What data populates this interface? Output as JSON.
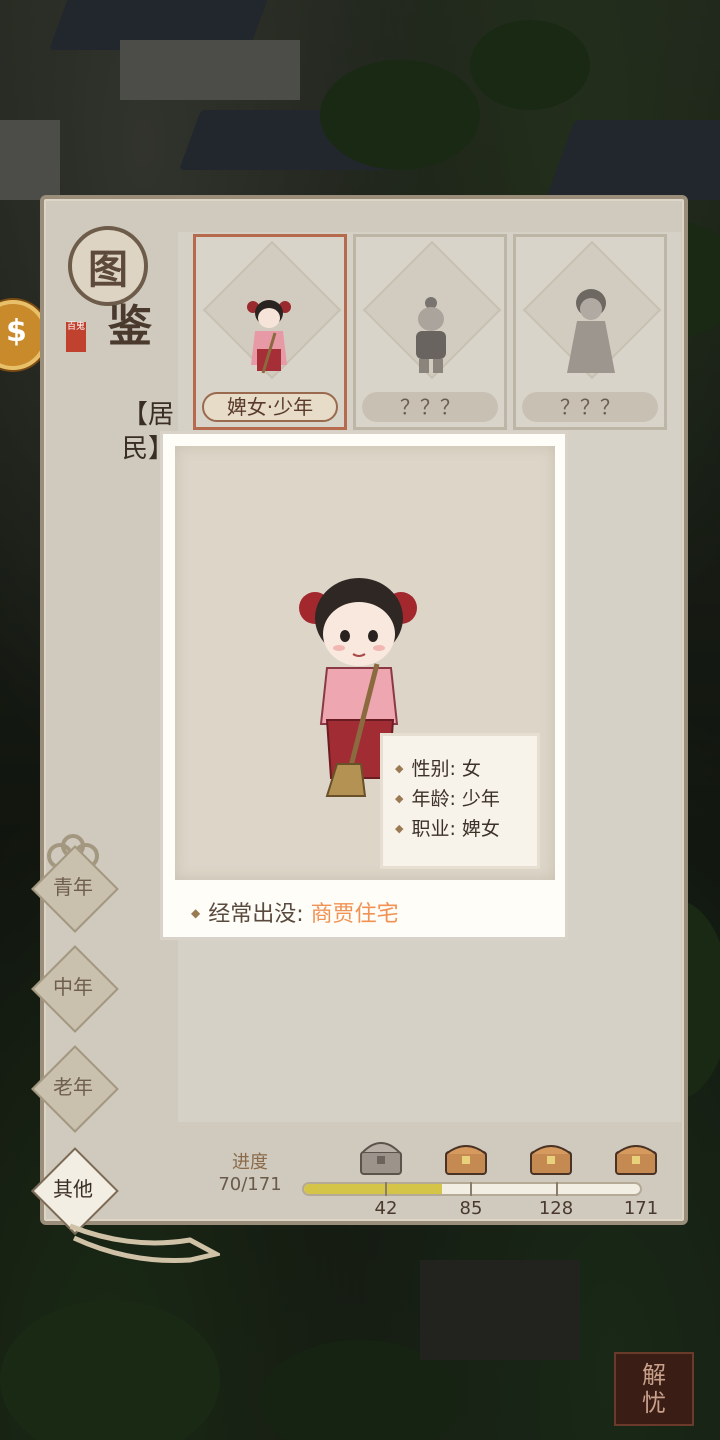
{
  "panel": {
    "logo_top": "图",
    "logo_bottom": "鉴",
    "logo_seal": "百鬼",
    "category": "【居民】"
  },
  "cards": [
    {
      "name": "婢女·少年",
      "selected": true
    },
    {
      "name": "？？？",
      "selected": false
    },
    {
      "name": "？？？",
      "selected": false
    }
  ],
  "age_tabs": [
    {
      "label": "青年",
      "active": false
    },
    {
      "label": "中年",
      "active": false
    },
    {
      "label": "老年",
      "active": false
    },
    {
      "label": "其他",
      "active": true
    }
  ],
  "progress": {
    "label": "进度",
    "value": "70/171",
    "current": 70,
    "max": 171,
    "milestones": [
      "42",
      "85",
      "128",
      "171"
    ]
  },
  "popup": {
    "gender_key": "性别:",
    "gender_value": "女",
    "age_key": "年龄:",
    "age_value": "少年",
    "job_key": "职业:",
    "job_value": "婢女",
    "haunt_key": "经常出没:",
    "haunt_value": "商贾住宅"
  },
  "corner_button": {
    "line1": "解",
    "line2": "忧"
  },
  "colors": {
    "accent_orange": "#f09254",
    "progress_fill": "#d4c447",
    "selected_border": "#b66a4e"
  }
}
